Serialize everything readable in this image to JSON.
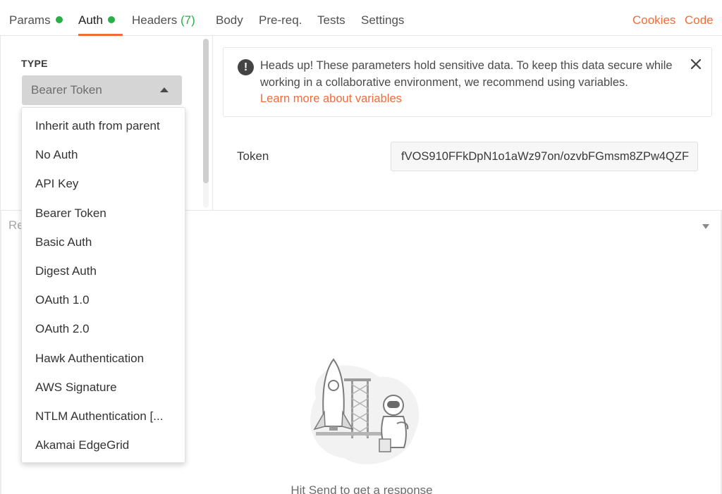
{
  "tabs": [
    {
      "label": "Params",
      "dot": true
    },
    {
      "label": "Auth",
      "dot": true,
      "active": true
    },
    {
      "label": "Headers",
      "count": "(7)"
    },
    {
      "label": "Body"
    },
    {
      "label": "Pre-req."
    },
    {
      "label": "Tests"
    },
    {
      "label": "Settings"
    }
  ],
  "header_links": {
    "cookies": "Cookies",
    "code": "Code"
  },
  "auth": {
    "type_label": "TYPE",
    "selected_type": "Bearer Token",
    "options": [
      "Inherit auth from parent",
      "No Auth",
      "API Key",
      "Bearer Token",
      "Basic Auth",
      "Digest Auth",
      "OAuth 1.0",
      "OAuth 2.0",
      "Hawk Authentication",
      "AWS Signature",
      "NTLM Authentication [...",
      "Akamai EdgeGrid"
    ]
  },
  "notice": {
    "icon": "exclamation-icon",
    "text": "Heads up! These parameters hold sensitive data. To keep this data secure while working in a collaborative environment, we recommend using variables.",
    "link": "Learn more about variables"
  },
  "token": {
    "label": "Token",
    "value": "fVOS910FFkDpN1o1aWz97on/ozvbFGmsm8ZPw4QZF"
  },
  "response": {
    "label": "Re",
    "hint": "Hit Send to get a response"
  },
  "colors": {
    "accent": "#f26b3a",
    "status_dot": "#26b047"
  }
}
